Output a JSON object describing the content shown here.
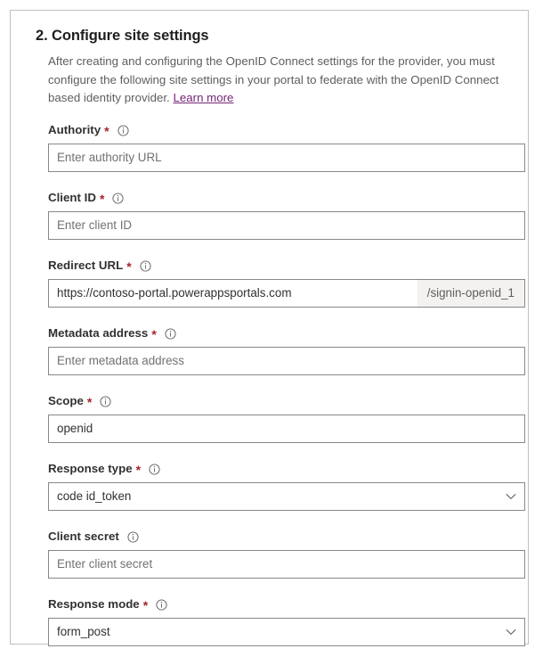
{
  "section": {
    "title": "2. Configure site settings",
    "description_before_link": "After creating and configuring the OpenID Connect settings for the provider, you must configure the following site settings in your portal to federate with the OpenID Connect based identity provider. ",
    "learn_more_label": "Learn more"
  },
  "icons": {
    "info": "info-icon",
    "chevron_down": "chevron-down-icon"
  },
  "colors": {
    "required_asterisk": "#a4262c",
    "link": "#742774",
    "label": "#323130",
    "description": "#605e5c",
    "border": "#8a8886",
    "addon_background": "#f3f2f1",
    "card_border": "#bfbfbf"
  },
  "fields": [
    {
      "name": "authority",
      "label": "Authority",
      "required": true,
      "required_marker": "*",
      "type": "text",
      "value": "",
      "placeholder": "Enter authority URL"
    },
    {
      "name": "client-id",
      "label": "Client ID",
      "required": true,
      "required_marker": "*",
      "type": "text",
      "value": "",
      "placeholder": "Enter client ID"
    },
    {
      "name": "redirect-url",
      "label": "Redirect URL",
      "required": true,
      "required_marker": "*",
      "type": "text-with-suffix",
      "value": "https://contoso-portal.powerappsportals.com",
      "placeholder": "",
      "suffix": "/signin-openid_1"
    },
    {
      "name": "metadata-address",
      "label": "Metadata address",
      "required": true,
      "required_marker": "*",
      "type": "text",
      "value": "",
      "placeholder": "Enter metadata address"
    },
    {
      "name": "scope",
      "label": "Scope",
      "required": true,
      "required_marker": "*",
      "type": "text",
      "value": "openid",
      "placeholder": ""
    },
    {
      "name": "response-type",
      "label": "Response type",
      "required": true,
      "required_marker": "*",
      "type": "select",
      "value": "code id_token"
    },
    {
      "name": "client-secret",
      "label": "Client secret",
      "required": false,
      "required_marker": "",
      "type": "text",
      "value": "",
      "placeholder": "Enter client secret"
    },
    {
      "name": "response-mode",
      "label": "Response mode",
      "required": true,
      "required_marker": "*",
      "type": "select",
      "value": "form_post"
    }
  ]
}
